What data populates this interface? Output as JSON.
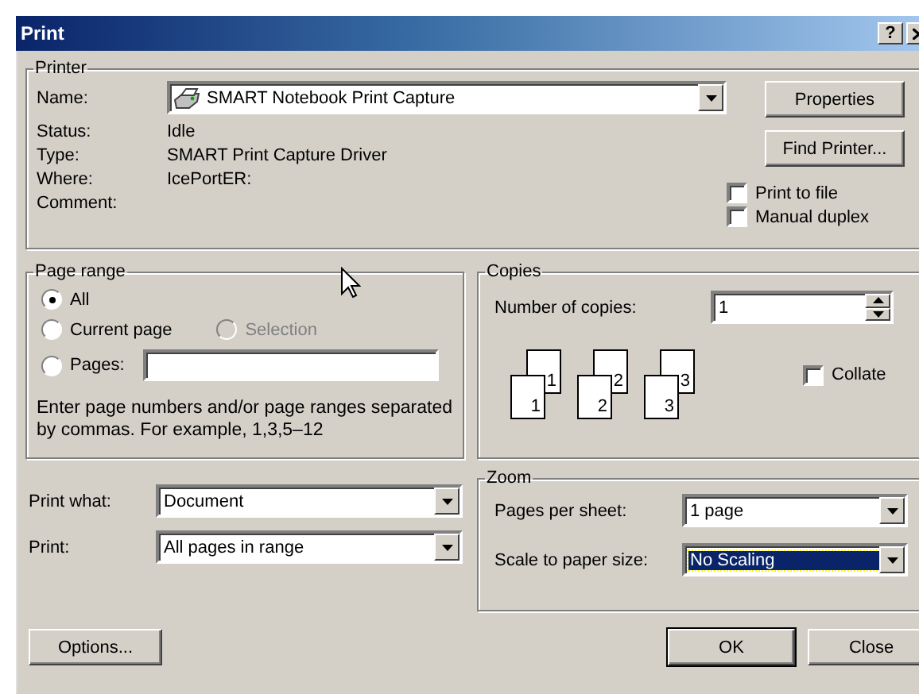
{
  "window": {
    "title": "Print",
    "help_button": "?"
  },
  "printer": {
    "legend": "Printer",
    "name_label": "Name:",
    "name_value": "SMART Notebook Print Capture",
    "properties": "Properties",
    "find": "Find Printer...",
    "info": [
      {
        "label": "Status:",
        "value": "Idle"
      },
      {
        "label": "Type:",
        "value": "SMART Print Capture Driver"
      },
      {
        "label": "Where:",
        "value": "IcePortER:"
      },
      {
        "label": "Comment:"
      }
    ],
    "checkboxes": [
      {
        "label": "Print to file",
        "checked": false
      },
      {
        "label": "Manual duplex",
        "checked": false
      }
    ]
  },
  "page_range": {
    "legend": "Page range",
    "rows": [
      [
        {
          "kind": "radio",
          "label": "All",
          "selected": true,
          "disabled": false
        }
      ],
      [
        {
          "kind": "radio",
          "label": "Current page",
          "selected": false,
          "disabled": false
        },
        {
          "kind": "radio",
          "label": "Selection",
          "selected": false,
          "disabled": true
        }
      ],
      [
        {
          "kind": "radio_field",
          "label": "Pages:",
          "selected": false,
          "disabled": false
        }
      ]
    ],
    "hint": "Enter page numbers and/or page ranges separated by commas.  For example, 1,3,5–12"
  },
  "copies": {
    "legend": "Copies",
    "label": "Number of copies:",
    "value": "1",
    "stacks": [
      {
        "back": "1",
        "front": "1"
      },
      {
        "back": "2",
        "front": "2"
      },
      {
        "back": "3",
        "front": "3"
      }
    ],
    "collate": {
      "label": "Collate",
      "checked": false
    }
  },
  "print_what": {
    "label": "Print what:",
    "value": "Document"
  },
  "print": {
    "label": "Print:",
    "value": "All pages in range"
  },
  "zoom": {
    "legend": "Zoom",
    "rows": [
      {
        "label": "Pages per sheet:",
        "value": "1 page",
        "selected": false
      },
      {
        "label": "Scale to paper size:",
        "value": "No Scaling",
        "selected": true
      }
    ]
  },
  "buttons": {
    "options": "Options...",
    "ok": "OK",
    "close": "Close"
  }
}
